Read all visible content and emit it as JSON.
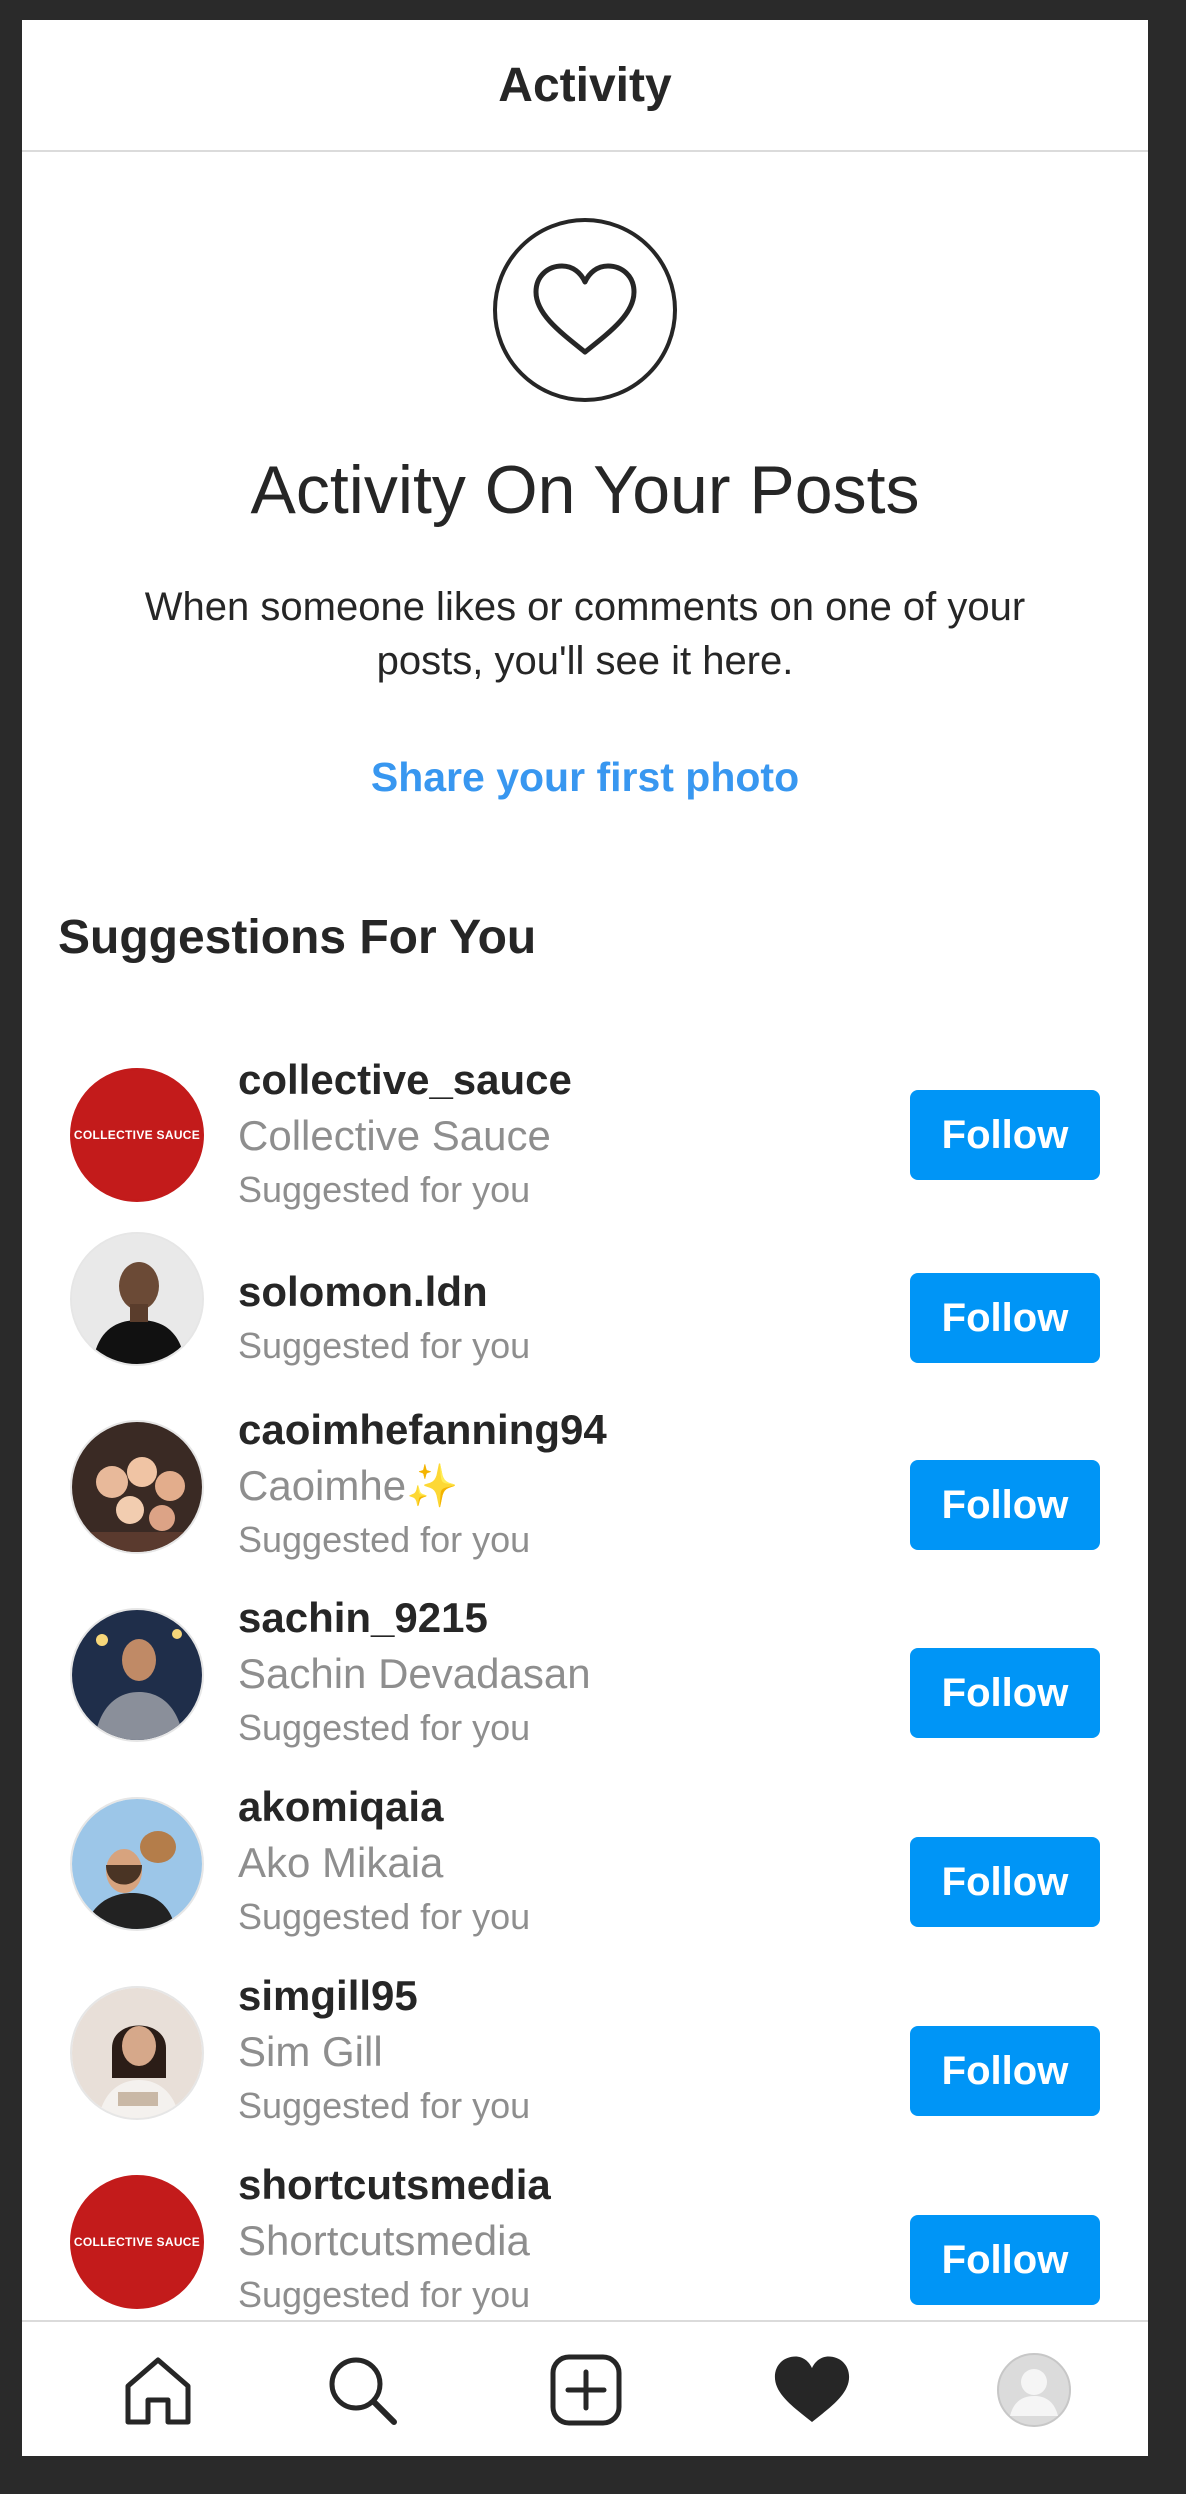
{
  "header": {
    "title": "Activity"
  },
  "hero": {
    "icon": "heart-outline-icon",
    "title": "Activity On Your Posts",
    "text": "When someone likes or comments on one of your posts, you'll see it here.",
    "link": "Share your first photo"
  },
  "suggestions": {
    "heading": "Suggestions For You",
    "follow_label": "Follow",
    "items": [
      {
        "username": "collective_sauce",
        "fullname": "Collective Sauce",
        "sub": "Suggested for you",
        "avatar_text": "COLLECTIVE SAUCE"
      },
      {
        "username": "solomon.ldn",
        "fullname": "",
        "sub": "Suggested for you"
      },
      {
        "username": "caoimhefanning94",
        "fullname": "Caoimhe✨",
        "sub": "Suggested for you"
      },
      {
        "username": "sachin_9215",
        "fullname": "Sachin Devadasan",
        "sub": "Suggested for you"
      },
      {
        "username": "akomiqaia",
        "fullname": "Ako Mikaia",
        "sub": "Suggested for you"
      },
      {
        "username": "simgill95",
        "fullname": "Sim Gill",
        "sub": "Suggested for you"
      },
      {
        "username": "shortcutsmedia",
        "fullname": "Shortcutsmedia",
        "sub": "Suggested for you",
        "avatar_text": "COLLECTIVE SAUCE"
      }
    ]
  },
  "bottom_nav": {
    "items": [
      "home-icon",
      "search-icon",
      "new-post-icon",
      "activity-heart-icon",
      "profile-icon"
    ]
  },
  "colors": {
    "accent": "#0095f6",
    "link": "#3897f0",
    "text": "#262626",
    "muted": "#8e8e8e",
    "logo_red": "#c31b1b"
  }
}
